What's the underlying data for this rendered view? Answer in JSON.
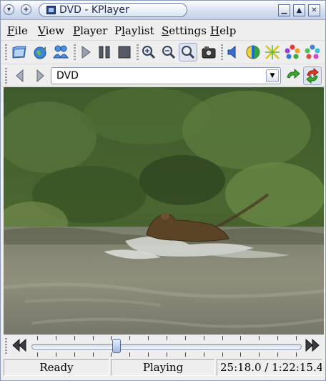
{
  "window": {
    "title": "DVD - KPlayer"
  },
  "menubar": {
    "items": [
      {
        "label": "File",
        "key": "F",
        "rest": "ile"
      },
      {
        "label": "View",
        "key": "V",
        "rest": "iew"
      },
      {
        "label": "Player",
        "key": "P",
        "rest": "layer"
      },
      {
        "label": "Playlist",
        "key": "l",
        "pre": "P",
        "rest": "aylist"
      },
      {
        "label": "Settings",
        "key": "S",
        "rest": "ettings"
      },
      {
        "label": "Help",
        "key": "H",
        "rest": "elp"
      }
    ]
  },
  "toolbar": {
    "icons": [
      "open-file-icon",
      "open-url-icon",
      "open-subtitles-icon",
      "play-icon",
      "pause-icon",
      "stop-icon",
      "zoom-in-icon",
      "zoom-out-icon",
      "zoom-reset-icon",
      "snapshot-icon",
      "volume-icon",
      "contrast-icon",
      "brightness-icon",
      "hue-icon",
      "saturation-icon"
    ]
  },
  "playlist_bar": {
    "current": "DVD"
  },
  "seek": {
    "position_fraction": 0.31
  },
  "status": {
    "state_left": "Ready",
    "state_mid": "Playing",
    "time": "25:18.0 / 1:22:15.4"
  },
  "colors": {
    "accent": "#3a6fd0",
    "title_text": "#1b2a52"
  }
}
